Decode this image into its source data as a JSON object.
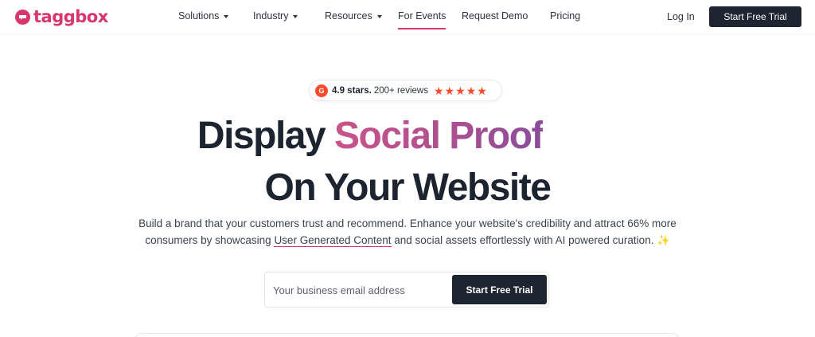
{
  "header": {
    "logo_text": "taggbox",
    "nav": [
      {
        "label": "Solutions",
        "dropdown": true
      },
      {
        "label": "Industry",
        "dropdown": true
      },
      {
        "label": "Resources",
        "dropdown": true
      },
      {
        "label": "For Events",
        "dropdown": false,
        "active": true
      },
      {
        "label": "Request Demo",
        "dropdown": false
      },
      {
        "label": "Pricing",
        "dropdown": false
      }
    ],
    "login_label": "Log In",
    "cta_label": "Start Free Trial"
  },
  "rating": {
    "badge_icon": "g2-logo-icon",
    "score": "4.9 stars.",
    "reviews": "200+ reviews",
    "stars": 5
  },
  "hero": {
    "line1_plain": "Display ",
    "line1_highlight": "Social Proof",
    "line2": "On Your Website",
    "sub_part1": "Build a brand that your customers trust and recommend. Enhance your website's credibility and attract 66% more consumers by showcasing ",
    "sub_link": "User Generated Content",
    "sub_part2": " and social assets effortlessly with AI powered curation."
  },
  "form": {
    "email_placeholder": "Your business email address",
    "cta_label": "Start Free Trial"
  },
  "colors": {
    "brand": "#d9366b",
    "dark": "#1d2530",
    "g2": "#ff492c"
  }
}
